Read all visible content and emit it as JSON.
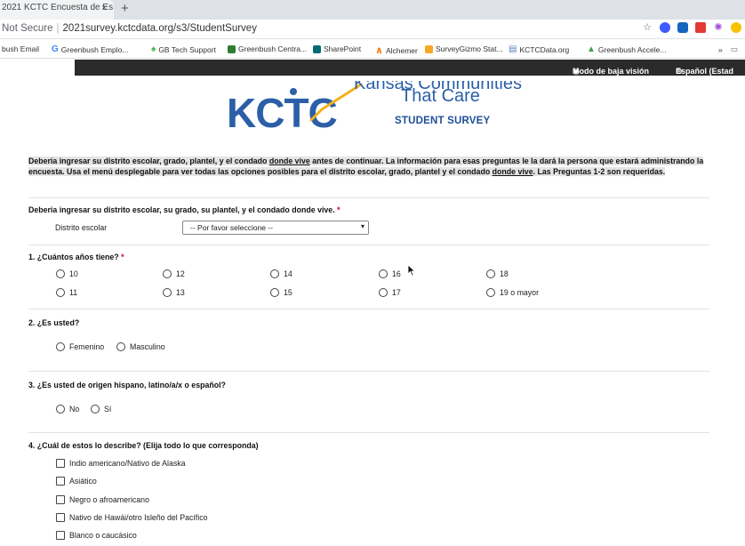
{
  "browser": {
    "tab_title": "2021 KCTC Encuesta de Es",
    "tab_close": "×",
    "new_tab": "+",
    "security": "Not Secure",
    "url": "2021survey.kctcdata.org/s3/StudentSurvey",
    "bookmarks": [
      "bush Email",
      "Greenbush Emplo...",
      "GB Tech Support",
      "Greenbush Centra...",
      "SharePoint",
      "Alchemer",
      "SurveyGizmo Stat...",
      "KCTCData.org",
      "Greenbush Accele..."
    ],
    "bookmark_more": "»",
    "colors": {
      "tabbar": "#dee1e6",
      "accent": "#1a73e8"
    }
  },
  "topbar": {
    "low_vision": "Modo de baja visión",
    "language": "Español (Estad"
  },
  "logo": {
    "mark": "KCTC",
    "line1": "Kansas Communities",
    "line2": "That Care",
    "line3": "STUDENT SURVEY",
    "color": "#2c5fa8"
  },
  "notice": {
    "part1": "Debería ingresar su distrito escolar, grado, plantel, y el condado ",
    "u1": "donde vive",
    "part2": " antes de continuar. La información para esas preguntas le la dará la persona que estará administrando la encuesta. Usa el menú desplegable para ver todas las opciones posibles para el distrito escolar, grado, plantel y el condado ",
    "u2": "donde vive",
    "part3": ". Las Preguntas 1-2 son requeridas."
  },
  "district_q": {
    "title": "Deberia ingresar su distrito escolar, su grado, su plantel, y el condado donde vive.",
    "required": "*",
    "label": "Distrito escolar",
    "select_value": "-- Por favor seleccione --"
  },
  "q1": {
    "title": "1. ¿Cuántos años tiene?",
    "required": "*",
    "options": [
      "10",
      "12",
      "14",
      "16",
      "18",
      "11",
      "13",
      "15",
      "17",
      "19 o mayor"
    ]
  },
  "q2": {
    "title": "2. ¿Es usted?",
    "options": [
      "Femenino",
      "Masculino"
    ]
  },
  "q3": {
    "title": "3. ¿Es usted de origen hispano, latino/a/x o español?",
    "options": [
      "No",
      "Sí"
    ]
  },
  "q4": {
    "title": "4. ¿Cuál de estos lo describe? (Elija todo lo que corresponda)",
    "options": [
      "Indio americano/Nativo de Alaska",
      "Asiático",
      "Negro o afroamericano",
      "Nativo de Hawái/otro Isleño del Pacífico",
      "Blanco o caucásico"
    ]
  }
}
